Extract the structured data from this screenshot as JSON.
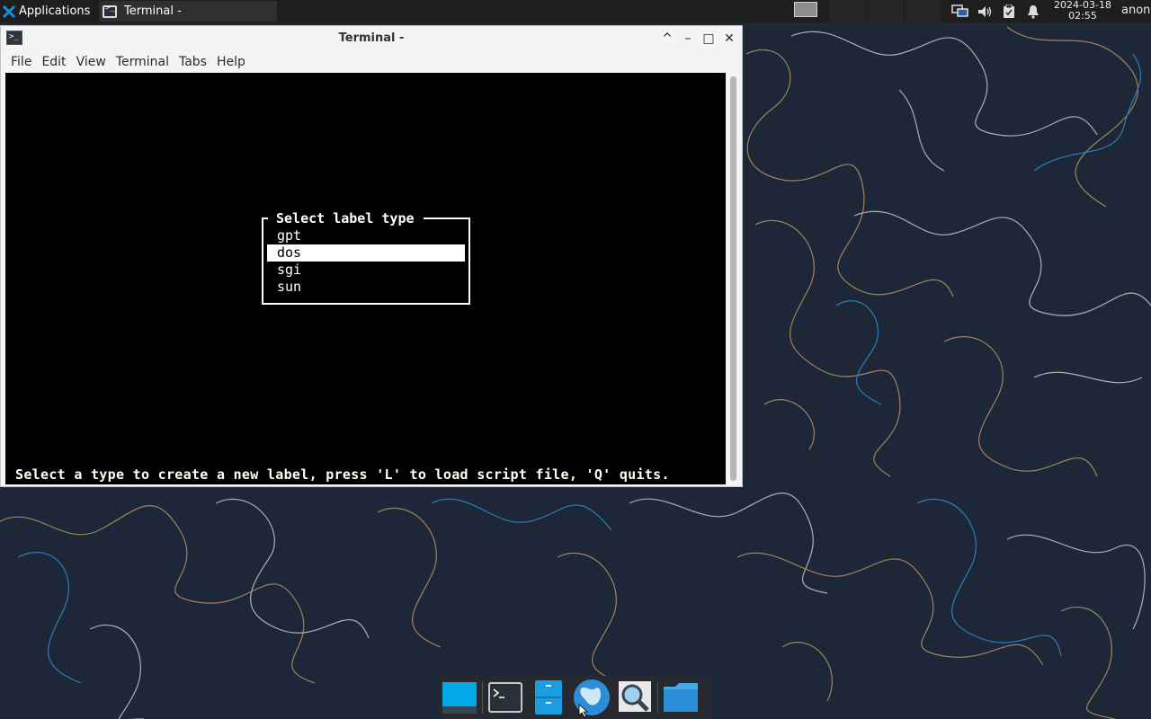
{
  "panel": {
    "apps_label": "Applications",
    "task_title": "Terminal -",
    "clock_date": "2024-03-18",
    "clock_time": "02:55",
    "user": "anon"
  },
  "window": {
    "title": "Terminal -",
    "controls": [
      "^",
      "–",
      "□",
      "✕"
    ],
    "menu": [
      "File",
      "Edit",
      "View",
      "Terminal",
      "Tabs",
      "Help"
    ]
  },
  "terminal": {
    "dialog_title": "Select label type",
    "options": [
      "gpt",
      "dos",
      "sgi",
      "sun"
    ],
    "selected_option": "dos",
    "status": "Select a type to create a new label, press 'L' to load script file, 'Q' quits."
  },
  "dock": {
    "items": [
      "show-desktop-icon",
      "terminal-icon",
      "file-manager-icon",
      "web-browser-icon",
      "app-finder-icon",
      "folder-icon"
    ]
  },
  "colors": {
    "panel_bg": "#1e1e1e",
    "wallpaper_bg": "#1d2737",
    "wallpaper_line_gold": "#b89460",
    "wallpaper_line_blue": "#2f8fcf",
    "accent": "#00a8e8"
  }
}
